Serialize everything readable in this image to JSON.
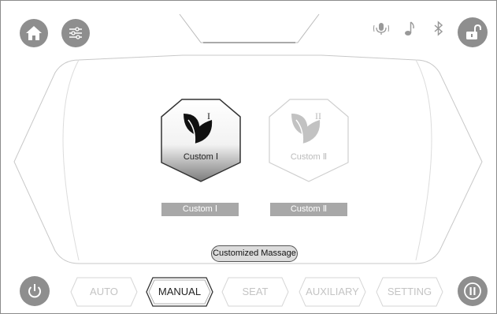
{
  "cards": [
    {
      "numeral": "I",
      "caption": "Custom Ⅰ",
      "label": "Custom Ⅰ"
    },
    {
      "numeral": "II",
      "caption": "Custom Ⅱ",
      "label": "Custom Ⅱ"
    }
  ],
  "main_button": "Customized Massage",
  "tabs": [
    {
      "label": "AUTO",
      "state": "inactive"
    },
    {
      "label": "MANUAL",
      "state": "active"
    },
    {
      "label": "SEAT",
      "state": "inactive"
    },
    {
      "label": "AUXILIARY",
      "state": "inactive"
    },
    {
      "label": "SETTING",
      "state": "inactive"
    }
  ],
  "icons": {
    "top_left": [
      "home-icon",
      "sliders-icon"
    ],
    "top_right": [
      "microphone-icon",
      "music-note-icon",
      "bluetooth-icon",
      "unlock-icon"
    ],
    "bottom": [
      "power-icon",
      "pause-icon"
    ]
  },
  "colors": {
    "button_gray": "#8e8e8e",
    "label_gray": "#a8a8a8",
    "outline": "#b5b5b5"
  }
}
